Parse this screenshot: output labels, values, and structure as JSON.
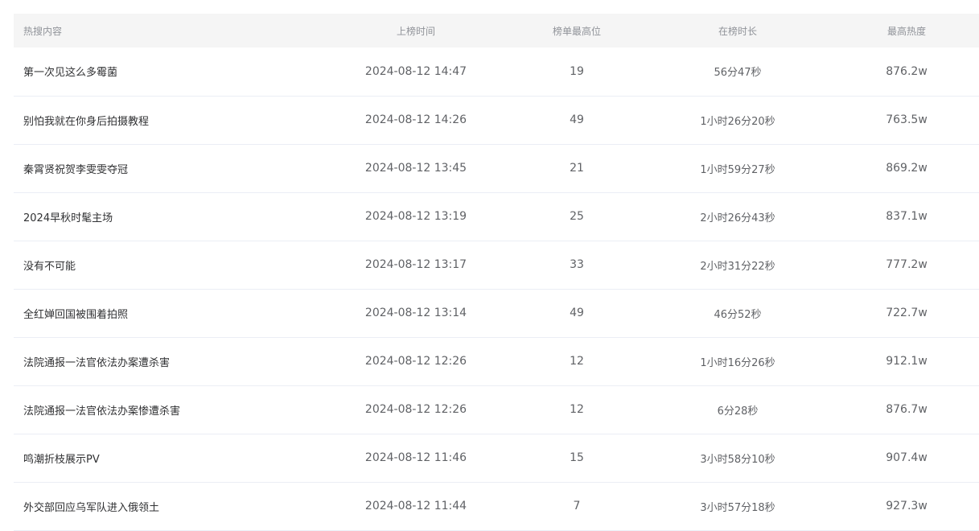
{
  "table": {
    "headers": [
      "热搜内容",
      "上榜时间",
      "榜单最高位",
      "在榜时长",
      "最高热度"
    ],
    "rows": [
      {
        "content": "第一次见这么多霉菌",
        "time": "2024-08-12 14:47",
        "rank": "19",
        "duration": "56分47秒",
        "heat": "876.2w"
      },
      {
        "content": "别怕我就在你身后拍摄教程",
        "time": "2024-08-12 14:26",
        "rank": "49",
        "duration": "1小时26分20秒",
        "heat": "763.5w"
      },
      {
        "content": "秦霄贤祝贺李雯雯夺冠",
        "time": "2024-08-12 13:45",
        "rank": "21",
        "duration": "1小时59分27秒",
        "heat": "869.2w"
      },
      {
        "content": "2024早秋时髦主场",
        "time": "2024-08-12 13:19",
        "rank": "25",
        "duration": "2小时26分43秒",
        "heat": "837.1w"
      },
      {
        "content": "没有不可能",
        "time": "2024-08-12 13:17",
        "rank": "33",
        "duration": "2小时31分22秒",
        "heat": "777.2w"
      },
      {
        "content": "全红婵回国被围着拍照",
        "time": "2024-08-12 13:14",
        "rank": "49",
        "duration": "46分52秒",
        "heat": "722.7w"
      },
      {
        "content": "法院通报一法官依法办案遭杀害",
        "time": "2024-08-12 12:26",
        "rank": "12",
        "duration": "1小时16分26秒",
        "heat": "912.1w"
      },
      {
        "content": "法院通报一法官依法办案惨遭杀害",
        "time": "2024-08-12 12:26",
        "rank": "12",
        "duration": "6分28秒",
        "heat": "876.7w"
      },
      {
        "content": "鸣潮折枝展示PV",
        "time": "2024-08-12 11:46",
        "rank": "15",
        "duration": "3小时58分10秒",
        "heat": "907.4w"
      },
      {
        "content": "外交部回应乌军队进入俄领土",
        "time": "2024-08-12 11:44",
        "rank": "7",
        "duration": "3小时57分18秒",
        "heat": "927.3w"
      }
    ]
  }
}
